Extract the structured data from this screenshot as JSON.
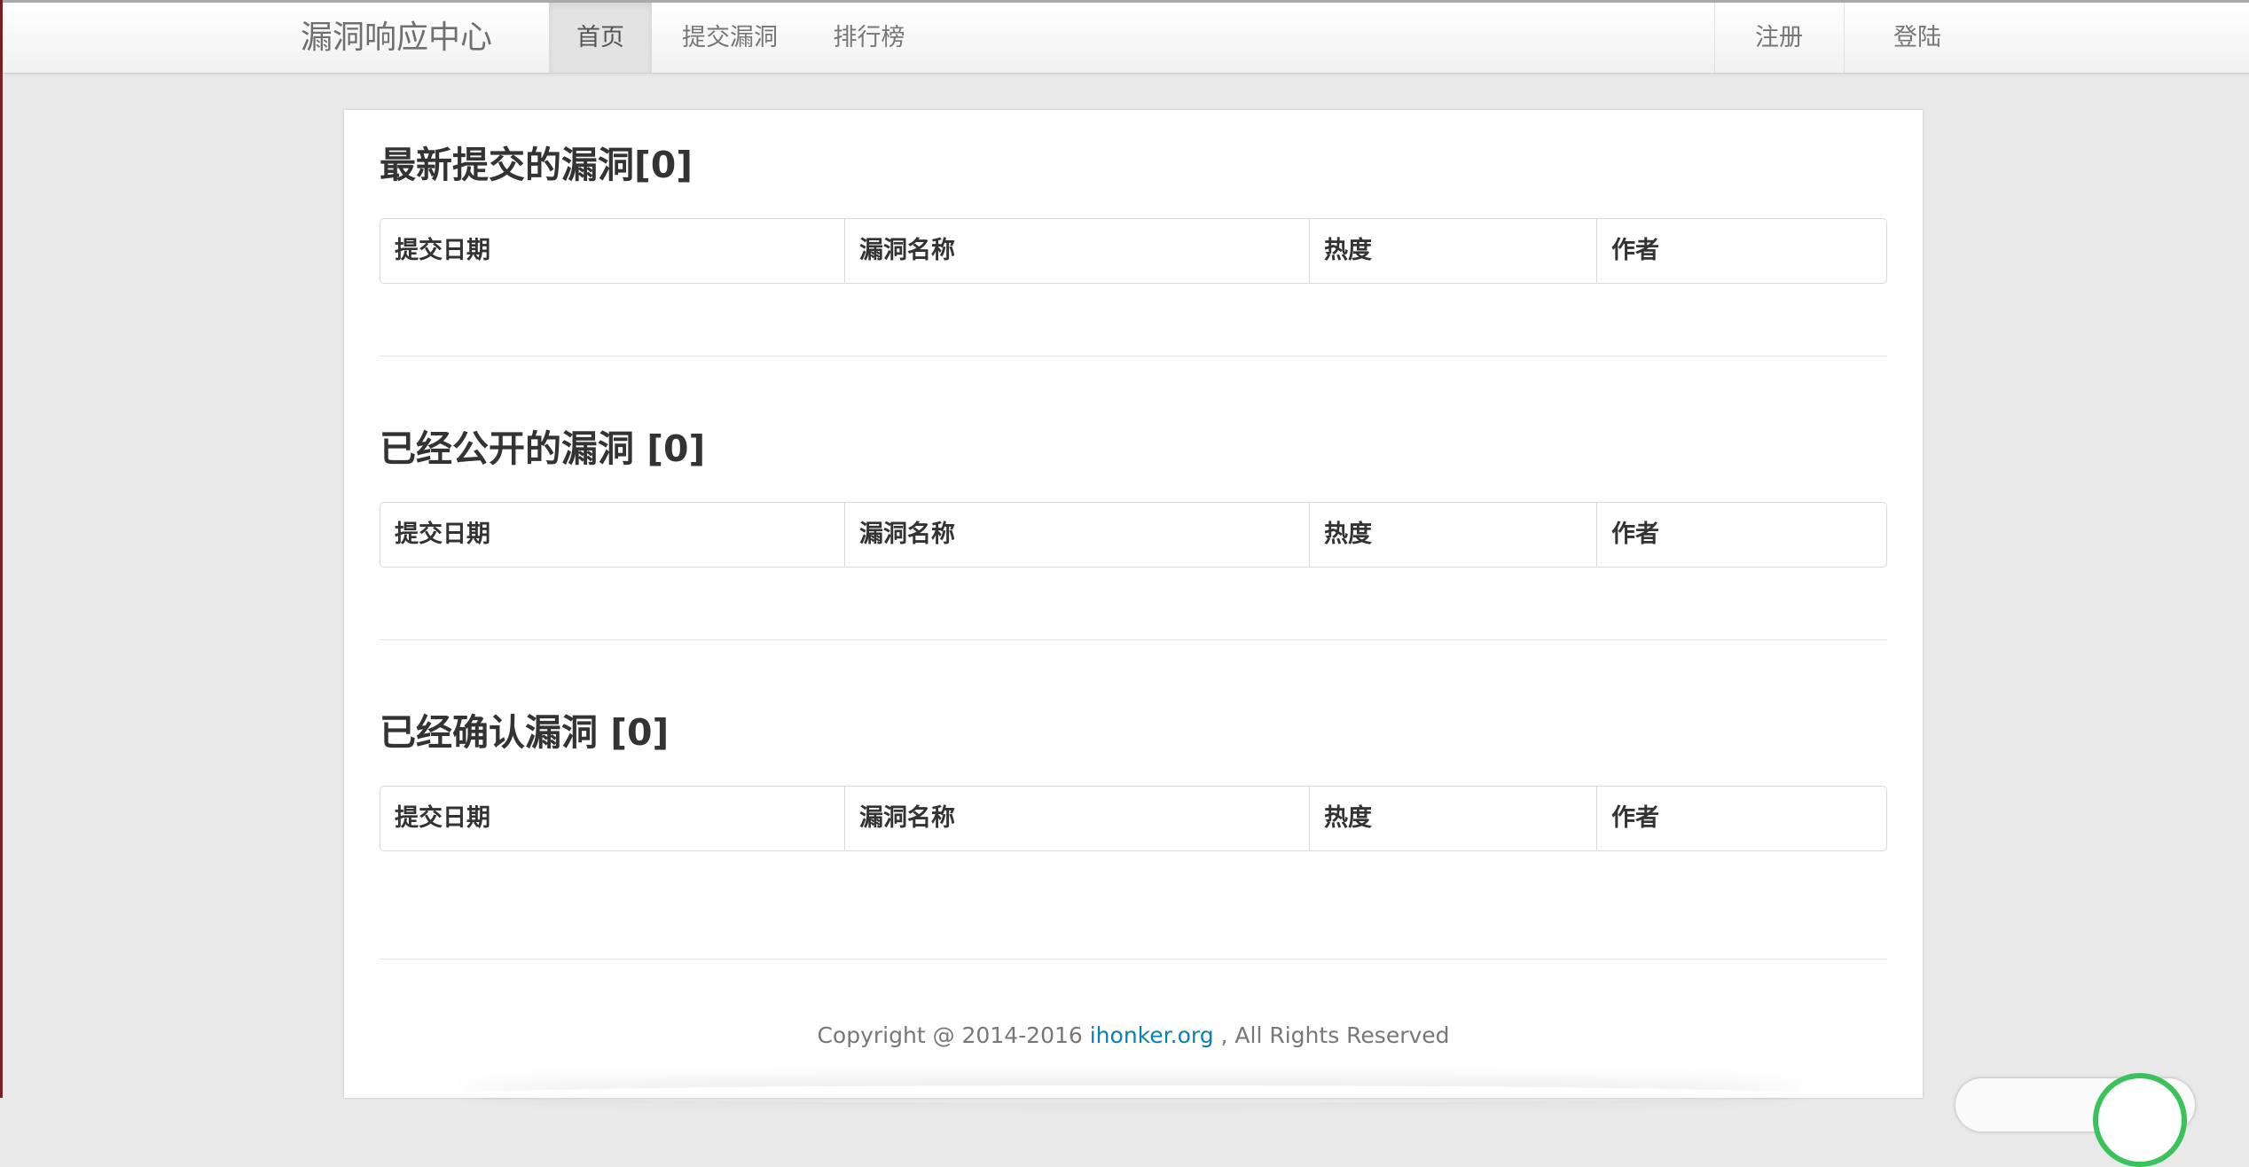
{
  "nav": {
    "brand": "漏洞响应中心",
    "items": [
      {
        "label": "首页",
        "active": true
      },
      {
        "label": "提交漏洞",
        "active": false
      },
      {
        "label": "排行榜",
        "active": false
      }
    ],
    "register": "注册",
    "login": "登陆"
  },
  "sections": [
    {
      "title": "最新提交的漏洞[0]"
    },
    {
      "title": "已经公开的漏洞 [0]"
    },
    {
      "title": "已经确认漏洞 [0]"
    }
  ],
  "table_headers": [
    "提交日期",
    "漏洞名称",
    "热度",
    "作者"
  ],
  "footer": {
    "prefix": "Copyright @ 2014-2016 ",
    "link": "ihonker.org",
    "suffix": " , All Rights Reserved"
  },
  "colors": {
    "link": "#0a7fb5",
    "active_nav_bg": "#e3e3e3",
    "page_bg": "#e9e9e9",
    "widget_ring": "#39c35a"
  }
}
